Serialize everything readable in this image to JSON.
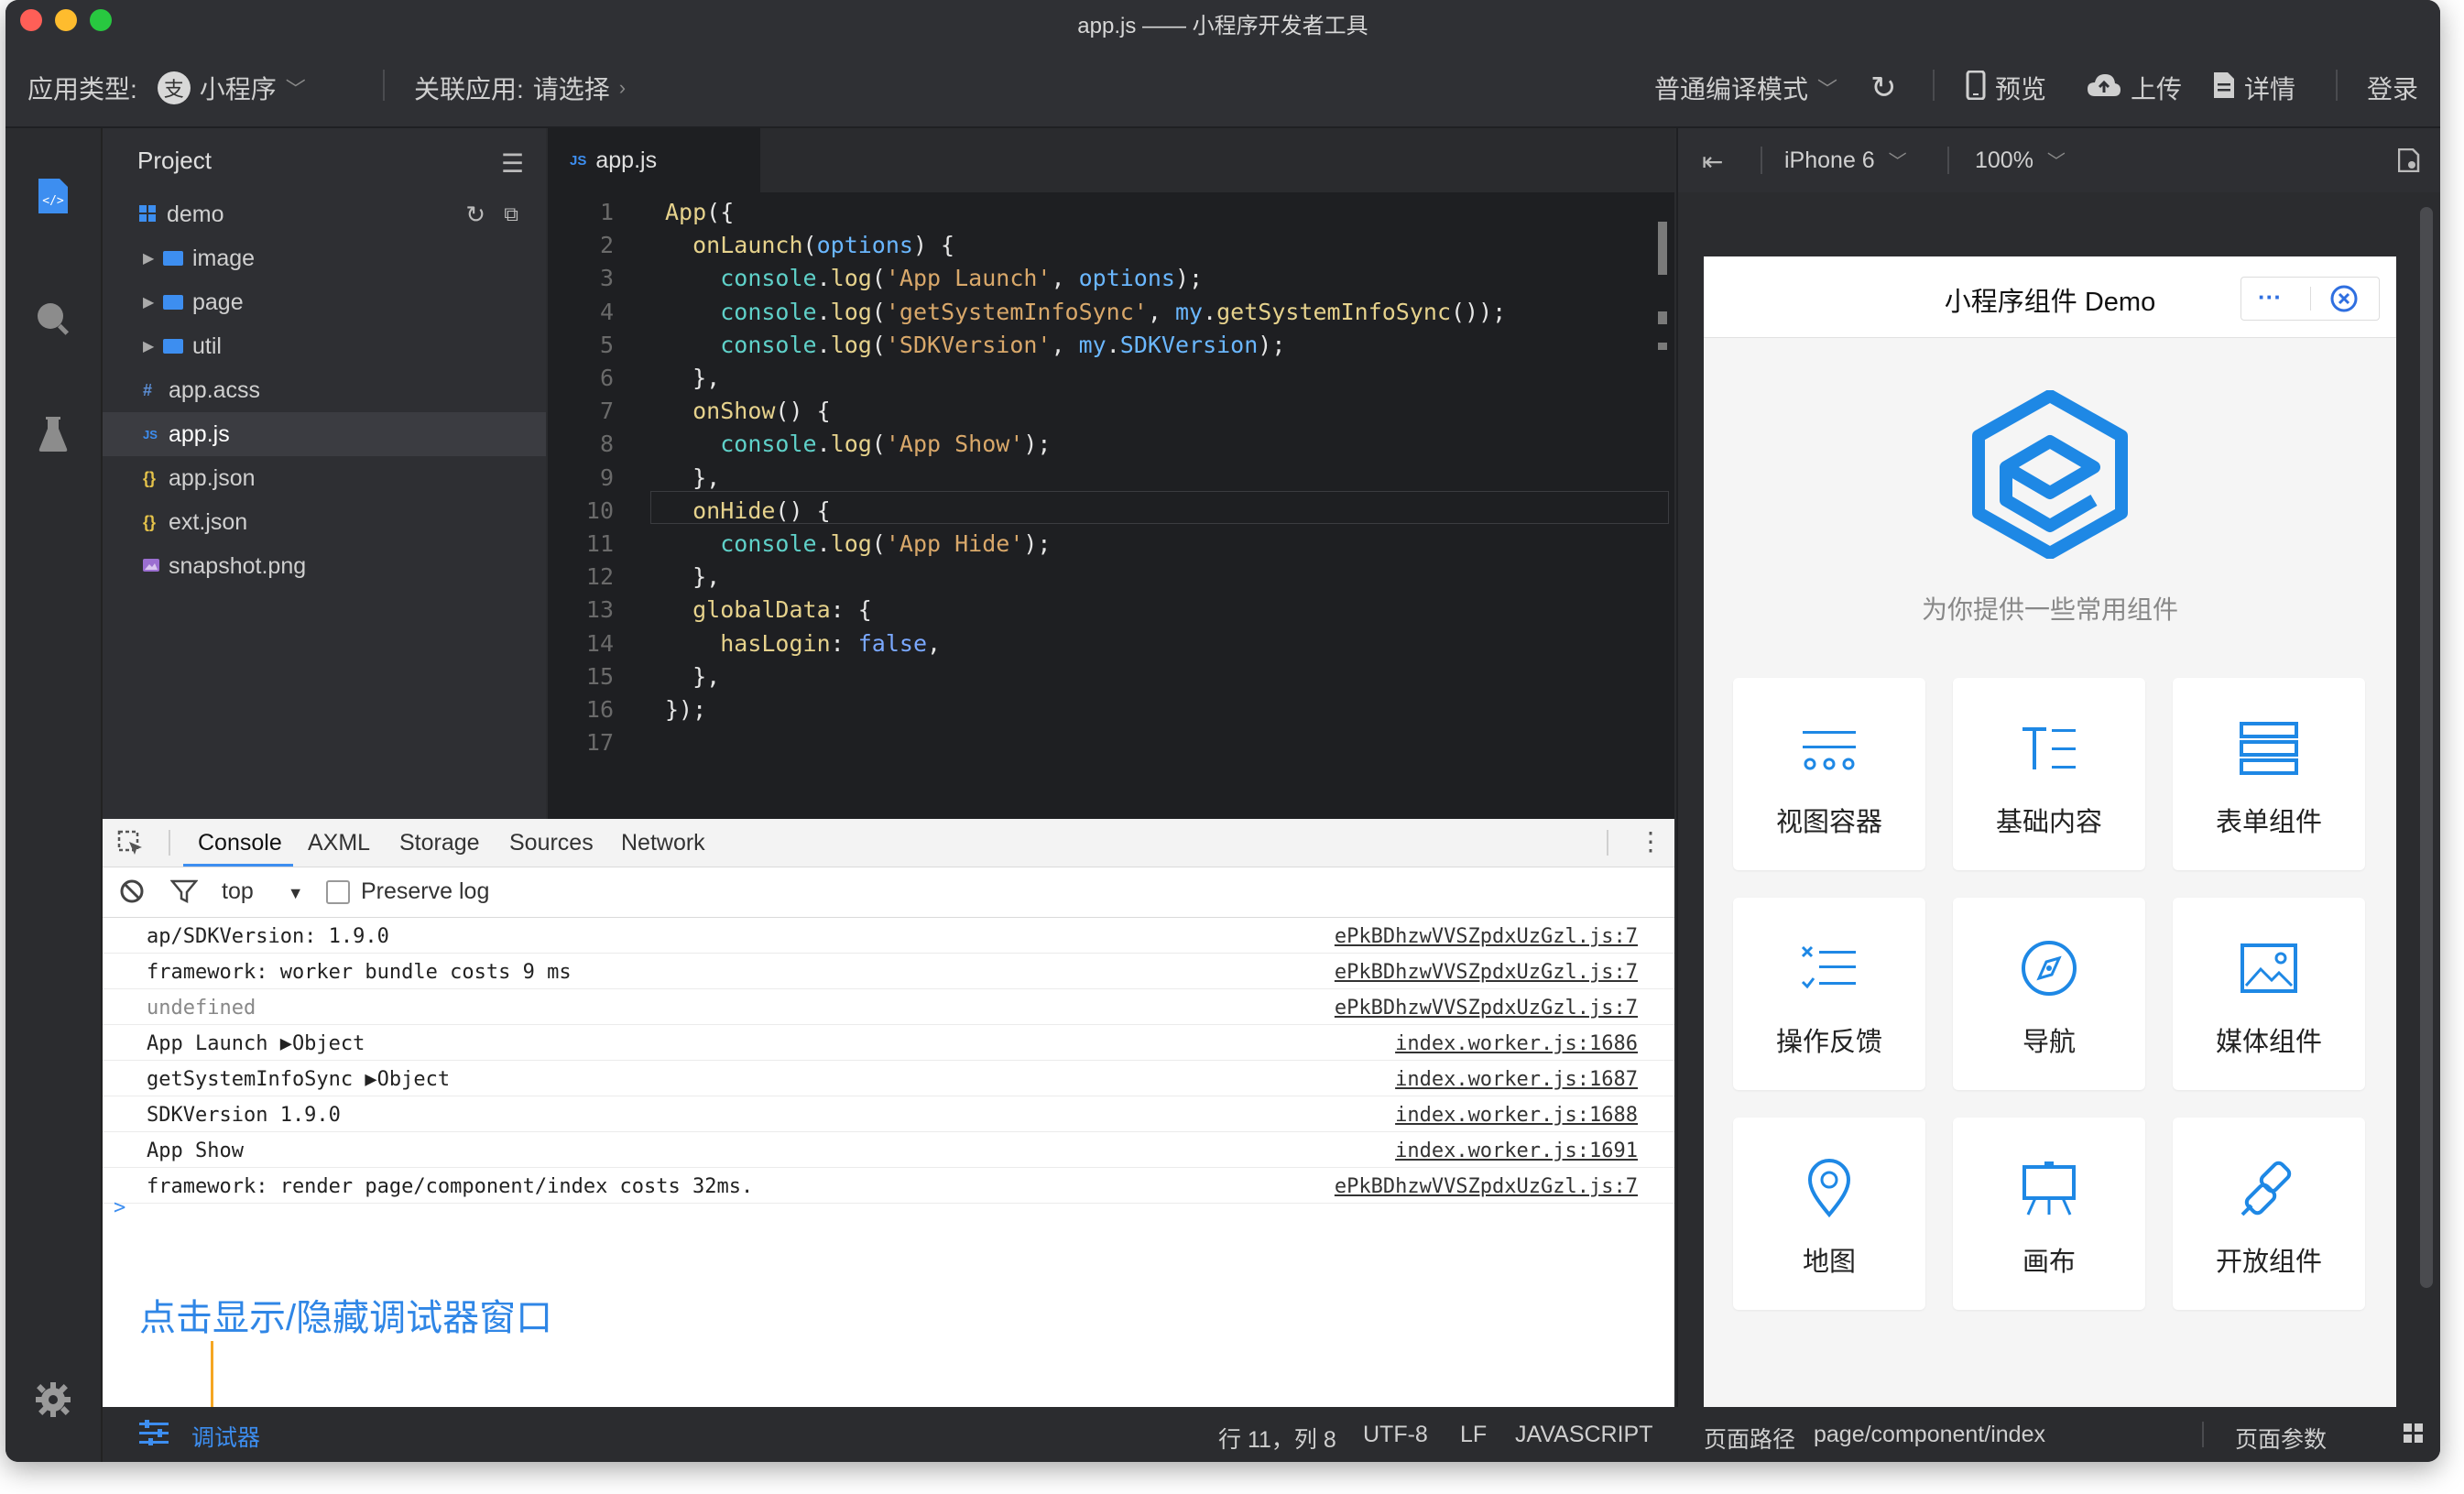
{
  "window": {
    "title": "app.js —— 小程序开发者工具"
  },
  "toolbar": {
    "app_type_label": "应用类型:",
    "app_type_value": "小程序",
    "linked_app_label": "关联应用:",
    "linked_app_value": "请选择",
    "compile_mode": "普通编译模式",
    "preview": "预览",
    "upload": "上传",
    "details": "详情",
    "login": "登录"
  },
  "project": {
    "header": "Project",
    "root": "demo",
    "items": [
      {
        "name": "image",
        "type": "folder"
      },
      {
        "name": "page",
        "type": "folder"
      },
      {
        "name": "util",
        "type": "folder"
      },
      {
        "name": "app.acss",
        "type": "acss",
        "icon": "#"
      },
      {
        "name": "app.js",
        "type": "js",
        "icon": "JS"
      },
      {
        "name": "app.json",
        "type": "json",
        "icon": "{}"
      },
      {
        "name": "ext.json",
        "type": "json",
        "icon": "{}"
      },
      {
        "name": "snapshot.png",
        "type": "image",
        "icon": "image-icon"
      }
    ]
  },
  "editor": {
    "tab": "app.js",
    "lines": [
      "App({",
      "  onLaunch(options) {",
      "    console.log('App Launch', options);",
      "    console.log('getSystemInfoSync', my.getSystemInfoSync());",
      "    console.log('SDKVersion', my.SDKVersion);",
      "  },",
      "  onShow() {",
      "    console.log('App Show');",
      "  },",
      "  onHide() {",
      "    console.log('App Hide');",
      "  },",
      "  globalData: {",
      "    hasLogin: false,",
      "  },",
      "});",
      ""
    ],
    "line_numbers": [
      "1",
      "2",
      "3",
      "4",
      "5",
      "6",
      "7",
      "8",
      "9",
      "10",
      "11",
      "12",
      "13",
      "14",
      "15",
      "16",
      "17"
    ]
  },
  "devtools": {
    "tabs": [
      "Console",
      "AXML",
      "Storage",
      "Sources",
      "Network"
    ],
    "active_tab": "Console",
    "context": "top",
    "preserve_log": "Preserve log",
    "logs": [
      {
        "msg": "ap/SDKVersion: 1.9.0",
        "src": "ePkBDhzwVVSZpdxUzGzl.js:7",
        "muted": false
      },
      {
        "msg": "framework: worker bundle costs 9 ms",
        "src": "ePkBDhzwVVSZpdxUzGzl.js:7",
        "muted": false
      },
      {
        "msg": "undefined",
        "src": "ePkBDhzwVVSZpdxUzGzl.js:7",
        "muted": true
      },
      {
        "msg": "App Launch ▶Object",
        "src": "index.worker.js:1686",
        "muted": false
      },
      {
        "msg": "getSystemInfoSync ▶Object",
        "src": "index.worker.js:1687",
        "muted": false
      },
      {
        "msg": "SDKVersion 1.9.0",
        "src": "index.worker.js:1688",
        "muted": false
      },
      {
        "msg": "App Show",
        "src": "index.worker.js:1691",
        "muted": false
      },
      {
        "msg": "framework: render page/component/index costs 32ms.",
        "src": "ePkBDhzwVVSZpdxUzGzl.js:7",
        "muted": false
      }
    ],
    "prompt": ">",
    "hint": "点击显示/隐藏调试器窗口"
  },
  "status": {
    "debugger": "调试器",
    "cursor": "行 11，列 8",
    "encoding": "UTF-8",
    "eol": "LF",
    "language": "JAVASCRIPT",
    "page_path_label": "页面路径",
    "page_path": "page/component/index",
    "page_params": "页面参数"
  },
  "simulator": {
    "device": "iPhone 6",
    "zoom": "100%",
    "nav_title": "小程序组件 Demo",
    "tagline": "为你提供一些常用组件",
    "cards": [
      {
        "label": "视图容器",
        "icon": "view-container-icon"
      },
      {
        "label": "基础内容",
        "icon": "text-icon"
      },
      {
        "label": "表单组件",
        "icon": "form-icon"
      },
      {
        "label": "操作反馈",
        "icon": "feedback-icon"
      },
      {
        "label": "导航",
        "icon": "compass-icon"
      },
      {
        "label": "媒体组件",
        "icon": "image-icon"
      },
      {
        "label": "地图",
        "icon": "map-pin-icon"
      },
      {
        "label": "画布",
        "icon": "canvas-icon"
      },
      {
        "label": "开放组件",
        "icon": "plug-icon"
      }
    ]
  },
  "colors": {
    "accent": "#3d8ef0",
    "hint": "#2f86e6",
    "hint_line": "#f5a623",
    "bg_dark": "#2b2c2f"
  }
}
